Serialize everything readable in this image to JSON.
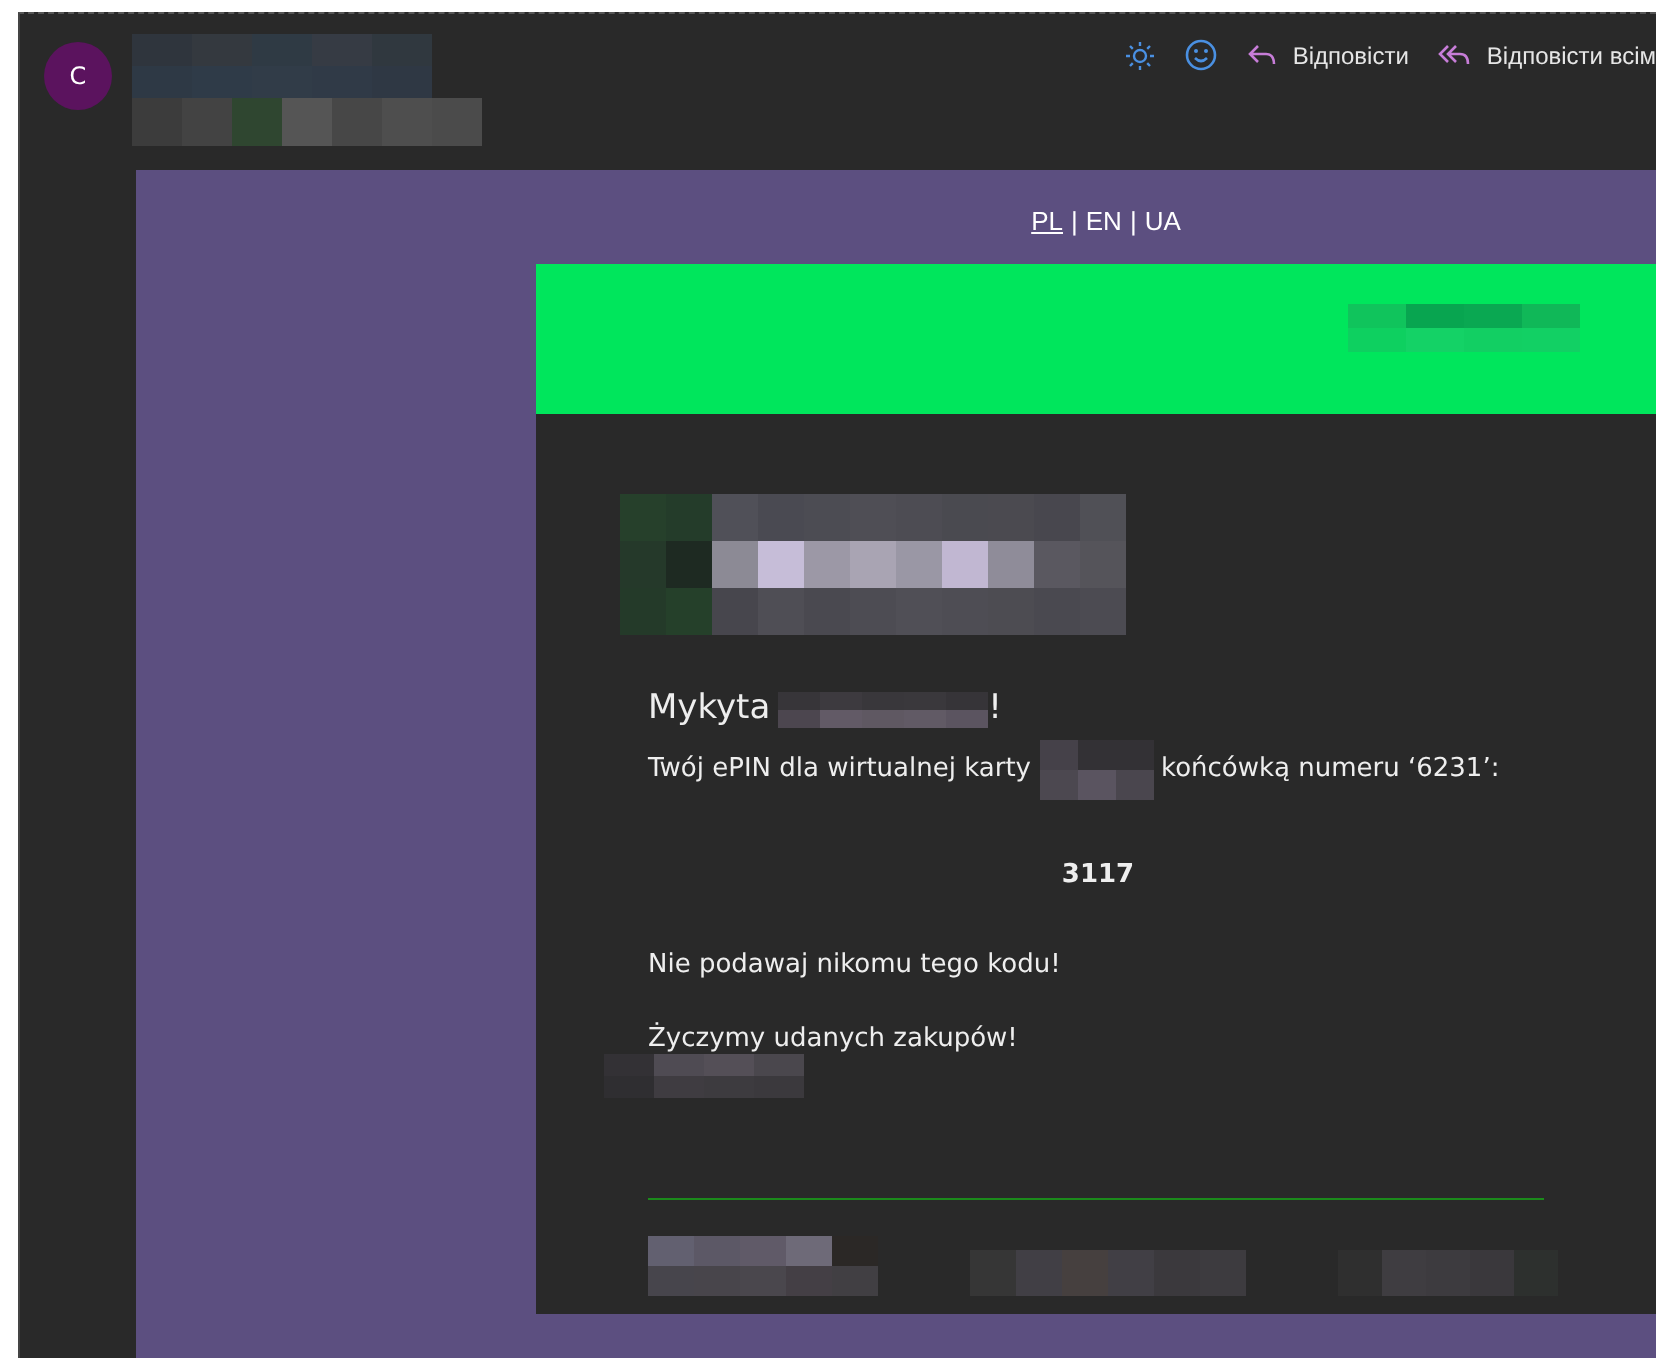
{
  "sender": {
    "avatar_initial": "C"
  },
  "toolbar": [
    {
      "kind": "brightness"
    },
    {
      "kind": "emoji"
    },
    {
      "kind": "reply",
      "label": "Відповісти"
    },
    {
      "kind": "reply_all",
      "label": "Відповісти всім"
    }
  ],
  "language_bar": {
    "items": [
      {
        "label": "PL",
        "selected": true
      },
      {
        "label": "EN",
        "selected": false
      },
      {
        "label": "UA",
        "selected": false
      }
    ],
    "separators": [
      "|",
      "|"
    ]
  },
  "message": {
    "greeting": "Mykyta",
    "greeting_end": "!",
    "pin_intro_start": "Twój ePIN dla wirtualnej karty",
    "pin_intro_end": "końcówką numeru ‘6231’:",
    "pin": "3117",
    "warning": "Nie podawaj nikomu tego kodu!",
    "closing": "Życzymy udanych zakupów!"
  }
}
